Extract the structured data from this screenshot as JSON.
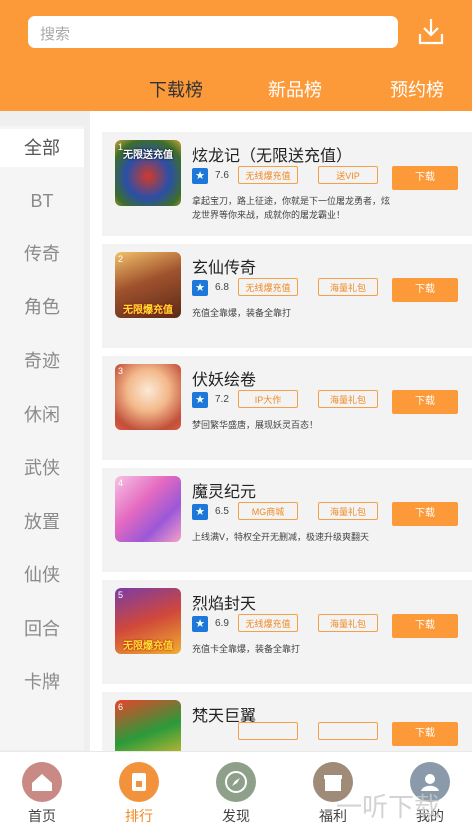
{
  "search": {
    "placeholder": "搜索"
  },
  "icons": {
    "download": "download-icon"
  },
  "tabs": [
    "下载榜",
    "新品榜",
    "预约榜"
  ],
  "sidebar": [
    "全部",
    "BT",
    "传奇",
    "角色",
    "奇迹",
    "休闲",
    "武侠",
    "放置",
    "仙侠",
    "回合",
    "卡牌"
  ],
  "games": [
    {
      "rank": "1",
      "name": "炫龙记（无限送充值）",
      "score": "7.6",
      "tag1": "无线爆充值",
      "tag2": "送VIP",
      "button": "下载",
      "desc": "拿起宝刀，路上征途，你就是下一位屠龙勇者，炫龙世界等你来战，成就你的屠龙霸业！",
      "icon_text": "无限送充值"
    },
    {
      "rank": "2",
      "name": "玄仙传奇",
      "score": "6.8",
      "tag1": "无线爆充值",
      "tag2": "海量礼包",
      "button": "下载",
      "desc": "充值全靠爆，装备全靠打",
      "icon_text": "无限爆充值"
    },
    {
      "rank": "3",
      "name": "伏妖绘卷",
      "score": "7.2",
      "tag1": "IP大作",
      "tag2": "海量礼包",
      "button": "下载",
      "desc": "梦回繁华盛唐，展现妖灵百态！",
      "icon_text": ""
    },
    {
      "rank": "4",
      "name": "魔灵纪元",
      "score": "6.5",
      "tag1": "MG商城",
      "tag2": "海量礼包",
      "button": "下载",
      "desc": "上线满V，特权全开无删减，极速升级爽翻天",
      "icon_text": ""
    },
    {
      "rank": "5",
      "name": "烈焰封天",
      "score": "6.9",
      "tag1": "无线爆充值",
      "tag2": "海量礼包",
      "button": "下载",
      "desc": "充值卡全靠爆，装备全靠打",
      "icon_text": "无限爆充值"
    },
    {
      "rank": "6",
      "name": "梵天巨翼",
      "score": "",
      "tag1": "",
      "tag2": "",
      "button": "下载",
      "desc": "",
      "icon_text": ""
    }
  ],
  "bottom_nav": [
    "首页",
    "排行",
    "发现",
    "福利",
    "我的"
  ],
  "watermark": "一听下载",
  "colors": {
    "accent": "#fc9a3a",
    "star": "#1e78d9"
  }
}
